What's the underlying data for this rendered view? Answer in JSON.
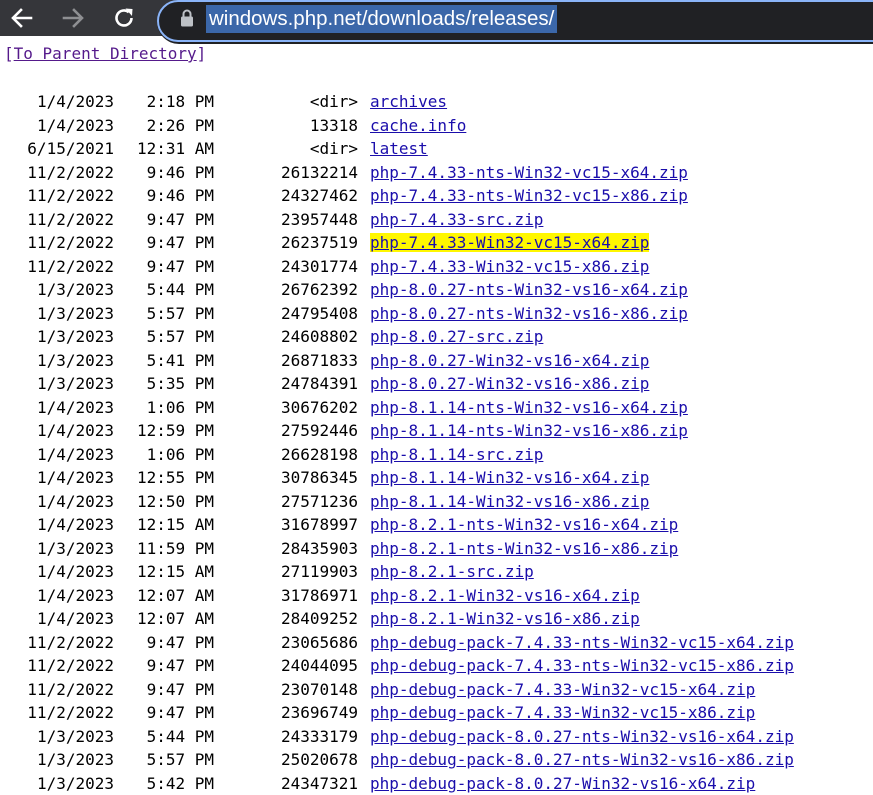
{
  "browser": {
    "url": "windows.php.net/downloads/releases/"
  },
  "page": {
    "parent_link": "To Parent Directory",
    "bracket_open": "[",
    "bracket_close": "]"
  },
  "rows": [
    {
      "date": "1/4/2023",
      "time": "2:18 PM",
      "size": "<dir>",
      "name": "archives",
      "highlight": false
    },
    {
      "date": "1/4/2023",
      "time": "2:26 PM",
      "size": "13318",
      "name": "cache.info",
      "highlight": false
    },
    {
      "date": "6/15/2021",
      "time": "12:31 AM",
      "size": "<dir>",
      "name": "latest",
      "highlight": false
    },
    {
      "date": "11/2/2022",
      "time": "9:46 PM",
      "size": "26132214",
      "name": "php-7.4.33-nts-Win32-vc15-x64.zip",
      "highlight": false
    },
    {
      "date": "11/2/2022",
      "time": "9:46 PM",
      "size": "24327462",
      "name": "php-7.4.33-nts-Win32-vc15-x86.zip",
      "highlight": false
    },
    {
      "date": "11/2/2022",
      "time": "9:47 PM",
      "size": "23957448",
      "name": "php-7.4.33-src.zip",
      "highlight": false
    },
    {
      "date": "11/2/2022",
      "time": "9:47 PM",
      "size": "26237519",
      "name": "php-7.4.33-Win32-vc15-x64.zip",
      "highlight": true
    },
    {
      "date": "11/2/2022",
      "time": "9:47 PM",
      "size": "24301774",
      "name": "php-7.4.33-Win32-vc15-x86.zip",
      "highlight": false
    },
    {
      "date": "1/3/2023",
      "time": "5:44 PM",
      "size": "26762392",
      "name": "php-8.0.27-nts-Win32-vs16-x64.zip",
      "highlight": false
    },
    {
      "date": "1/3/2023",
      "time": "5:57 PM",
      "size": "24795408",
      "name": "php-8.0.27-nts-Win32-vs16-x86.zip",
      "highlight": false
    },
    {
      "date": "1/3/2023",
      "time": "5:57 PM",
      "size": "24608802",
      "name": "php-8.0.27-src.zip",
      "highlight": false
    },
    {
      "date": "1/3/2023",
      "time": "5:41 PM",
      "size": "26871833",
      "name": "php-8.0.27-Win32-vs16-x64.zip",
      "highlight": false
    },
    {
      "date": "1/3/2023",
      "time": "5:35 PM",
      "size": "24784391",
      "name": "php-8.0.27-Win32-vs16-x86.zip",
      "highlight": false
    },
    {
      "date": "1/4/2023",
      "time": "1:06 PM",
      "size": "30676202",
      "name": "php-8.1.14-nts-Win32-vs16-x64.zip",
      "highlight": false
    },
    {
      "date": "1/4/2023",
      "time": "12:59 PM",
      "size": "27592446",
      "name": "php-8.1.14-nts-Win32-vs16-x86.zip",
      "highlight": false
    },
    {
      "date": "1/4/2023",
      "time": "1:06 PM",
      "size": "26628198",
      "name": "php-8.1.14-src.zip",
      "highlight": false
    },
    {
      "date": "1/4/2023",
      "time": "12:55 PM",
      "size": "30786345",
      "name": "php-8.1.14-Win32-vs16-x64.zip",
      "highlight": false
    },
    {
      "date": "1/4/2023",
      "time": "12:50 PM",
      "size": "27571236",
      "name": "php-8.1.14-Win32-vs16-x86.zip",
      "highlight": false
    },
    {
      "date": "1/4/2023",
      "time": "12:15 AM",
      "size": "31678997",
      "name": "php-8.2.1-nts-Win32-vs16-x64.zip",
      "highlight": false
    },
    {
      "date": "1/3/2023",
      "time": "11:59 PM",
      "size": "28435903",
      "name": "php-8.2.1-nts-Win32-vs16-x86.zip",
      "highlight": false
    },
    {
      "date": "1/4/2023",
      "time": "12:15 AM",
      "size": "27119903",
      "name": "php-8.2.1-src.zip",
      "highlight": false
    },
    {
      "date": "1/4/2023",
      "time": "12:07 AM",
      "size": "31786971",
      "name": "php-8.2.1-Win32-vs16-x64.zip",
      "highlight": false
    },
    {
      "date": "1/4/2023",
      "time": "12:07 AM",
      "size": "28409252",
      "name": "php-8.2.1-Win32-vs16-x86.zip",
      "highlight": false
    },
    {
      "date": "11/2/2022",
      "time": "9:47 PM",
      "size": "23065686",
      "name": "php-debug-pack-7.4.33-nts-Win32-vc15-x64.zip",
      "highlight": false
    },
    {
      "date": "11/2/2022",
      "time": "9:47 PM",
      "size": "24044095",
      "name": "php-debug-pack-7.4.33-nts-Win32-vc15-x86.zip",
      "highlight": false
    },
    {
      "date": "11/2/2022",
      "time": "9:47 PM",
      "size": "23070148",
      "name": "php-debug-pack-7.4.33-Win32-vc15-x64.zip",
      "highlight": false
    },
    {
      "date": "11/2/2022",
      "time": "9:47 PM",
      "size": "23696749",
      "name": "php-debug-pack-7.4.33-Win32-vc15-x86.zip",
      "highlight": false
    },
    {
      "date": "1/3/2023",
      "time": "5:44 PM",
      "size": "24333179",
      "name": "php-debug-pack-8.0.27-nts-Win32-vs16-x64.zip",
      "highlight": false
    },
    {
      "date": "1/3/2023",
      "time": "5:57 PM",
      "size": "25020678",
      "name": "php-debug-pack-8.0.27-nts-Win32-vs16-x86.zip",
      "highlight": false
    },
    {
      "date": "1/3/2023",
      "time": "5:42 PM",
      "size": "24347321",
      "name": "php-debug-pack-8.0.27-Win32-vs16-x64.zip",
      "highlight": false
    }
  ],
  "colors": {
    "chrome_bg": "#35363a",
    "omnibox_bg": "#202124",
    "focus_ring": "#8ab4f8",
    "url_selection": "#3b67a9",
    "link": "#1a0dab",
    "visited_link": "#551a8b",
    "highlight": "#fff700"
  },
  "icons": {
    "back": "arrow-left-icon",
    "forward": "arrow-right-icon",
    "reload": "reload-icon",
    "security": "lock-icon"
  }
}
